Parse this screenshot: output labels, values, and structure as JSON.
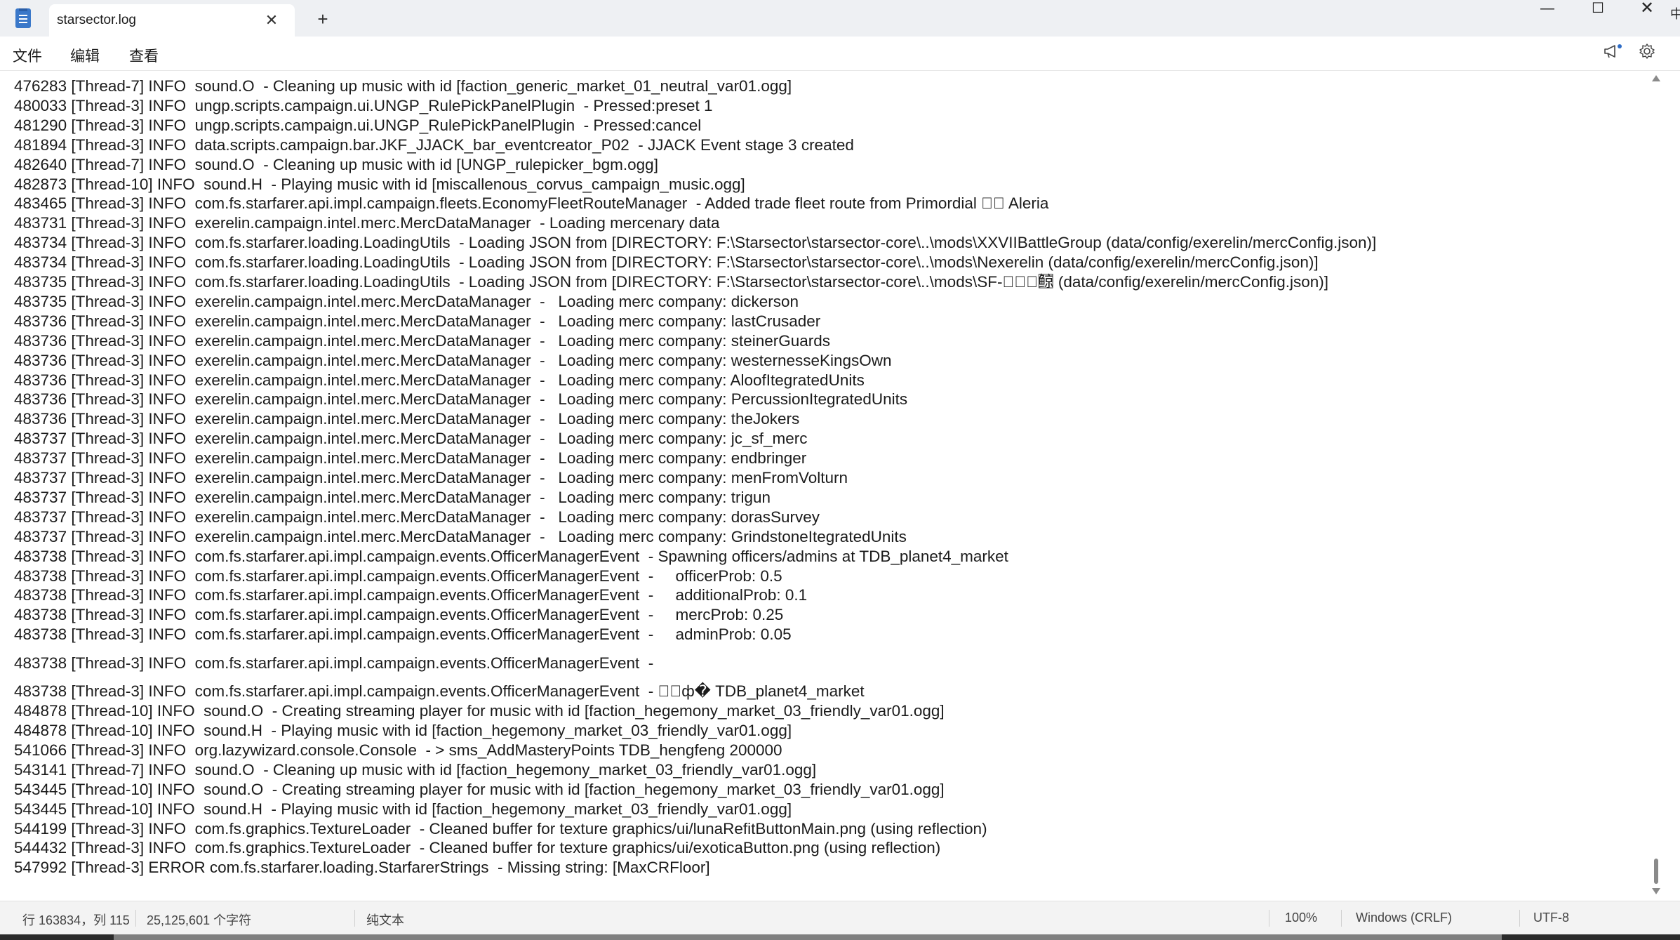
{
  "window": {
    "tab_title": "starsector.log",
    "tab_close": "✕",
    "new_tab": "+",
    "minimize": "—",
    "maximize": "☐",
    "close": "✕",
    "edge_glyph": "中"
  },
  "menu": {
    "file": "文件",
    "edit": "编辑",
    "view": "查看"
  },
  "icons": {
    "announce": "announcement-icon",
    "settings": "gear-icon"
  },
  "log_lines": [
    "476283 [Thread-7] INFO  sound.O  - Cleaning up music with id [faction_generic_market_01_neutral_var01.ogg]",
    "480033 [Thread-3] INFO  ungp.scripts.campaign.ui.UNGP_RulePickPanelPlugin  - Pressed:preset 1",
    "481290 [Thread-3] INFO  ungp.scripts.campaign.ui.UNGP_RulePickPanelPlugin  - Pressed:cancel",
    "481894 [Thread-3] INFO  data.scripts.campaign.bar.JKF_JJACK_bar_eventcreator_P02  - JJACK Event stage 3 created",
    "482640 [Thread-7] INFO  sound.O  - Cleaning up music with id [UNGP_rulepicker_bgm.ogg]",
    "482873 [Thread-10] INFO  sound.H  - Playing music with id [miscallenous_corvus_campaign_music.ogg]",
    "483465 [Thread-3] INFO  com.fs.starfarer.api.impl.campaign.fleets.EconomyFleetRouteManager  - Added trade fleet route from Primordial ⃞⃞ Aleria",
    "483731 [Thread-3] INFO  exerelin.campaign.intel.merc.MercDataManager  - Loading mercenary data",
    "483734 [Thread-3] INFO  com.fs.starfarer.loading.LoadingUtils  - Loading JSON from [DIRECTORY: F:\\Starsector\\starsector-core\\..\\mods\\XXVIIBattleGroup (data/config/exerelin/mercConfig.json)]",
    "483734 [Thread-3] INFO  com.fs.starfarer.loading.LoadingUtils  - Loading JSON from [DIRECTORY: F:\\Starsector\\starsector-core\\..\\mods\\Nexerelin (data/config/exerelin/mercConfig.json)]",
    "483735 [Thread-3] INFO  com.fs.starfarer.loading.LoadingUtils  - Loading JSON from [DIRECTORY: F:\\Starsector\\starsector-core\\..\\mods\\SF-⃞⃞⃞鲸⃞⃞ (data/config/exerelin/mercConfig.json)]",
    "483735 [Thread-3] INFO  exerelin.campaign.intel.merc.MercDataManager  -   Loading merc company: dickerson",
    "483736 [Thread-3] INFO  exerelin.campaign.intel.merc.MercDataManager  -   Loading merc company: lastCrusader",
    "483736 [Thread-3] INFO  exerelin.campaign.intel.merc.MercDataManager  -   Loading merc company: steinerGuards",
    "483736 [Thread-3] INFO  exerelin.campaign.intel.merc.MercDataManager  -   Loading merc company: westernesseKingsOwn",
    "483736 [Thread-3] INFO  exerelin.campaign.intel.merc.MercDataManager  -   Loading merc company: AloofItegratedUnits",
    "483736 [Thread-3] INFO  exerelin.campaign.intel.merc.MercDataManager  -   Loading merc company: PercussionItegratedUnits",
    "483736 [Thread-3] INFO  exerelin.campaign.intel.merc.MercDataManager  -   Loading merc company: theJokers",
    "483737 [Thread-3] INFO  exerelin.campaign.intel.merc.MercDataManager  -   Loading merc company: jc_sf_merc",
    "483737 [Thread-3] INFO  exerelin.campaign.intel.merc.MercDataManager  -   Loading merc company: endbringer",
    "483737 [Thread-3] INFO  exerelin.campaign.intel.merc.MercDataManager  -   Loading merc company: menFromVolturn",
    "483737 [Thread-3] INFO  exerelin.campaign.intel.merc.MercDataManager  -   Loading merc company: trigun",
    "483737 [Thread-3] INFO  exerelin.campaign.intel.merc.MercDataManager  -   Loading merc company: dorasSurvey",
    "483737 [Thread-3] INFO  exerelin.campaign.intel.merc.MercDataManager  -   Loading merc company: GrindstoneItegratedUnits",
    "483738 [Thread-3] INFO  com.fs.starfarer.api.impl.campaign.events.OfficerManagerEvent  - Spawning officers/admins at TDB_planet4_market",
    "483738 [Thread-3] INFO  com.fs.starfarer.api.impl.campaign.events.OfficerManagerEvent  -     officerProb: 0.5",
    "483738 [Thread-3] INFO  com.fs.starfarer.api.impl.campaign.events.OfficerManagerEvent  -     additionalProb: 0.1",
    "483738 [Thread-3] INFO  com.fs.starfarer.api.impl.campaign.events.OfficerManagerEvent  -     mercProb: 0.25",
    "483738 [Thread-3] INFO  com.fs.starfarer.api.impl.campaign.events.OfficerManagerEvent  -     adminProb: 0.05",
    "483738 [Thread-3] INFO  com.fs.starfarer.api.impl.campaign.events.OfficerManagerEvent  -",
    "483738 [Thread-3] INFO  com.fs.starfarer.api.impl.campaign.events.OfficerManagerEvent  - ⃞⃞ф� TDB_planet4_market",
    "484878 [Thread-10] INFO  sound.O  - Creating streaming player for music with id [faction_hegemony_market_03_friendly_var01.ogg]",
    "484878 [Thread-10] INFO  sound.H  - Playing music with id [faction_hegemony_market_03_friendly_var01.ogg]",
    "541066 [Thread-3] INFO  org.lazywizard.console.Console  - > sms_AddMasteryPoints TDB_hengfeng 200000",
    "543141 [Thread-7] INFO  sound.O  - Cleaning up music with id [faction_hegemony_market_03_friendly_var01.ogg]",
    "543445 [Thread-10] INFO  sound.O  - Creating streaming player for music with id [faction_hegemony_market_03_friendly_var01.ogg]",
    "543445 [Thread-10] INFO  sound.H  - Playing music with id [faction_hegemony_market_03_friendly_var01.ogg]",
    "544199 [Thread-3] INFO  com.fs.graphics.TextureLoader  - Cleaned buffer for texture graphics/ui/lunaRefitButtonMain.png (using reflection)",
    "544432 [Thread-3] INFO  com.fs.graphics.TextureLoader  - Cleaned buffer for texture graphics/ui/exoticaButton.png (using reflection)",
    "547992 [Thread-3] ERROR com.fs.starfarer.loading.StarfarerStrings  - Missing string: [MaxCRFloor]"
  ],
  "status": {
    "position": "行 163834，列 115",
    "chars": "25,125,601 个字符",
    "format": "纯文本",
    "zoom": "100%",
    "line_ending": "Windows (CRLF)",
    "encoding": "UTF-8"
  }
}
